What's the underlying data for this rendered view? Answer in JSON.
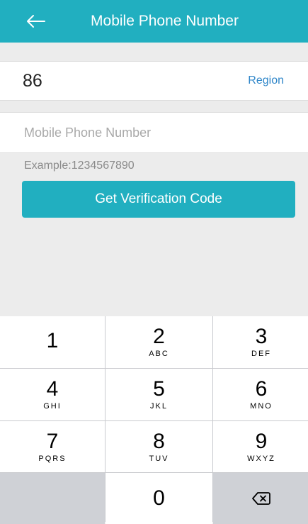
{
  "header": {
    "title": "Mobile Phone Number",
    "back_icon": "arrow-left-icon",
    "color": "#21afc0"
  },
  "region": {
    "code": "86",
    "link_label": "Region",
    "link_color": "#2f86c9"
  },
  "phone": {
    "placeholder": "Mobile Phone Number",
    "value": ""
  },
  "example_text": "Example:1234567890",
  "verify_button": {
    "label": "Get Verification Code"
  },
  "keypad": {
    "keys": [
      {
        "digit": "1",
        "letters": ""
      },
      {
        "digit": "2",
        "letters": "ABC"
      },
      {
        "digit": "3",
        "letters": "DEF"
      },
      {
        "digit": "4",
        "letters": "GHI"
      },
      {
        "digit": "5",
        "letters": "JKL"
      },
      {
        "digit": "6",
        "letters": "MNO"
      },
      {
        "digit": "7",
        "letters": "PQRS"
      },
      {
        "digit": "8",
        "letters": "TUV"
      },
      {
        "digit": "9",
        "letters": "WXYZ"
      },
      {
        "digit": "0",
        "letters": ""
      }
    ],
    "backspace_icon": "backspace-icon"
  }
}
